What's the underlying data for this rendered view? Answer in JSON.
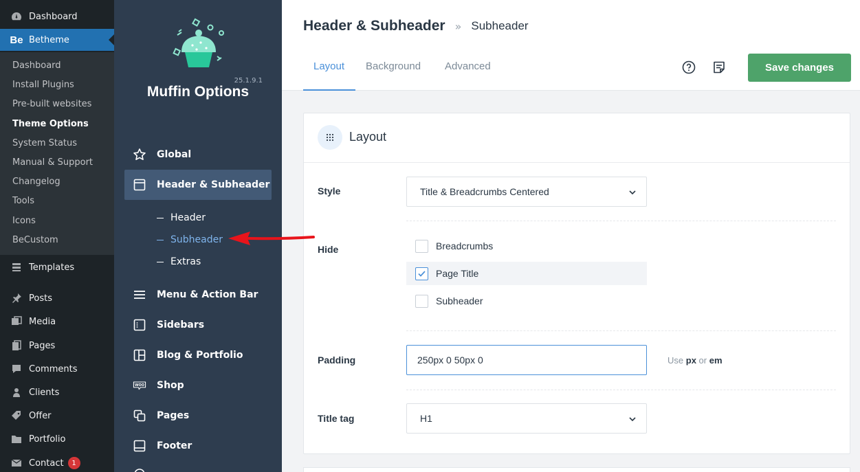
{
  "wp_sidebar": {
    "dashboard": "Dashboard",
    "betheme": "Betheme",
    "betheme_logo": "Be",
    "submenu": [
      "Dashboard",
      "Install Plugins",
      "Pre-built websites",
      "Theme Options",
      "System Status",
      "Manual & Support",
      "Changelog",
      "Tools",
      "Icons",
      "BeCustom"
    ],
    "current_sub": "Theme Options",
    "items": [
      "Templates",
      "Posts",
      "Media",
      "Pages",
      "Comments",
      "Clients",
      "Offer",
      "Portfolio",
      "Contact"
    ],
    "contact_badge": "1"
  },
  "muffin": {
    "version": "25.1.9.1",
    "title": "Muffin Options",
    "menu": {
      "global": "Global",
      "header_subheader": "Header & Subheader",
      "sub_header": "Header",
      "sub_subheader": "Subheader",
      "sub_extras": "Extras",
      "menu_action_bar": "Menu & Action Bar",
      "sidebars": "Sidebars",
      "blog_portfolio": "Blog & Portfolio",
      "shop": "Shop",
      "pages": "Pages",
      "footer": "Footer"
    },
    "woo_icon_text": "WOO"
  },
  "topbar": {
    "title": "Header & Subheader",
    "separator": "»",
    "current": "Subheader",
    "tabs": [
      "Layout",
      "Background",
      "Advanced"
    ],
    "active_tab": "Layout",
    "save_label": "Save changes"
  },
  "panel": {
    "title": "Layout",
    "style_label": "Style",
    "style_value": "Title & Breadcrumbs Centered",
    "hide_label": "Hide",
    "hide_options": [
      {
        "label": "Breadcrumbs",
        "checked": false
      },
      {
        "label": "Page Title",
        "checked": true
      },
      {
        "label": "Subheader",
        "checked": false
      }
    ],
    "padding_label": "Padding",
    "padding_value": "250px 0 50px 0",
    "unit_hint_prefix": "Use",
    "unit_px": "px",
    "unit_or": "or",
    "unit_em": "em",
    "title_tag_label": "Title tag",
    "title_tag_value": "H1"
  },
  "colors": {
    "wp_bg": "#1d2327",
    "wp_active": "#2271b1",
    "muffin_bg": "#2e3d4f",
    "accent": "#4a90d9",
    "save_green": "#4ea36a",
    "arrow_red": "#e8141b"
  }
}
